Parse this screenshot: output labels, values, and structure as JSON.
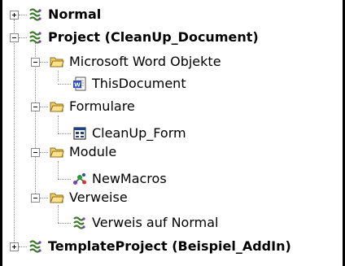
{
  "tree": {
    "normal": {
      "label": "Normal",
      "expander": "+"
    },
    "project": {
      "label": "Project (CleanUp_Document)",
      "expander": "−",
      "folders": [
        {
          "label": "Microsoft Word Objekte",
          "child": "ThisDocument"
        },
        {
          "label": "Formulare",
          "child": "CleanUp_Form"
        },
        {
          "label": "Module",
          "child": "NewMacros"
        },
        {
          "label": "Verweise",
          "child": "Verweis auf Normal"
        }
      ]
    },
    "template_project": {
      "label": "TemplateProject (Beispiel_AddIn)",
      "expander": "+"
    }
  },
  "icons": {
    "project": "vba-project-icon",
    "folder": "open-folder-icon",
    "word_document": "word-document-icon",
    "userform": "userform-icon",
    "module": "module-icon",
    "reference": "reference-icon"
  },
  "colors": {
    "folder": "#f2cf63",
    "word_blue": "#2b4fb5",
    "tree_line": "#8c8c8c"
  }
}
